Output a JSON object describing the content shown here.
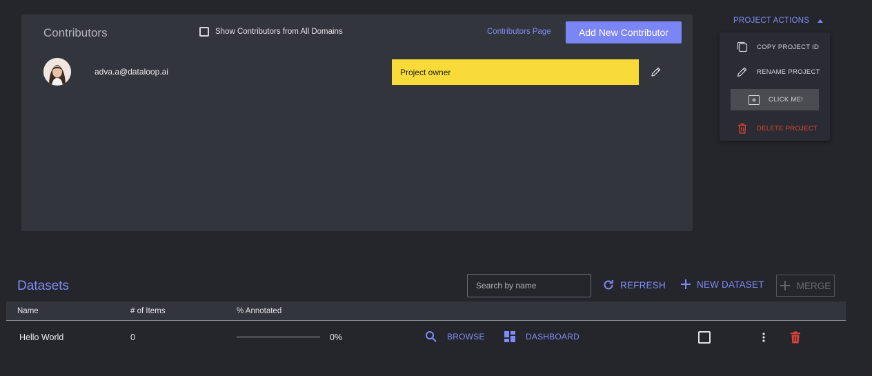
{
  "contributors": {
    "title": "Contributors",
    "show_all_label": "Show Contributors from All Domains",
    "page_link": "Contributors Page",
    "add_button": "Add New Contributor",
    "members": [
      {
        "email": "adva.a@dataloop.ai",
        "role": "Project owner"
      }
    ]
  },
  "project_actions": {
    "header": "PROJECT ACTIONS",
    "items": [
      {
        "label": "COPY PROJECT ID",
        "icon": "copy-icon"
      },
      {
        "label": "RENAME PROJECT",
        "icon": "pencil-icon"
      },
      {
        "label": "CLICK ME!",
        "icon": "plus-box-icon"
      },
      {
        "label": "DELETE PROJECT",
        "icon": "trash-icon"
      }
    ]
  },
  "datasets": {
    "title": "Datasets",
    "search_placeholder": "Search by name",
    "refresh_label": "REFRESH",
    "new_dataset_label": "NEW DATASET",
    "merge_label": "MERGE",
    "columns": [
      "Name",
      "# of Items",
      "% Annotated"
    ],
    "rows": [
      {
        "name": "Hello World",
        "items": "0",
        "annotated_percent": "0%",
        "annotated_fraction": 0,
        "browse_label": "BROWSE",
        "dashboard_label": "DASHBOARD"
      }
    ]
  },
  "colors": {
    "accent": "#7f8cf5",
    "role_badge": "#f8da39",
    "danger": "#e0433a",
    "background": "#25262c",
    "card": "#33353c"
  }
}
